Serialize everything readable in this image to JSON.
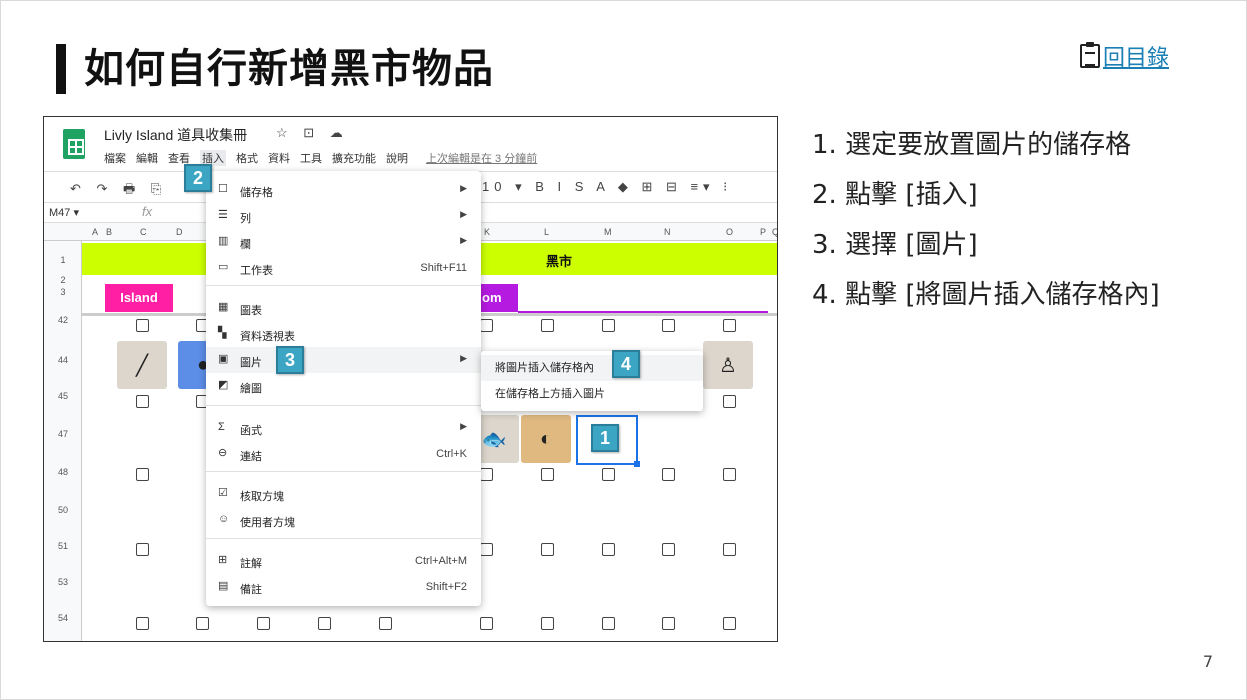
{
  "slide": {
    "title": "如何自行新增黑市物品",
    "toc_link": "回目錄",
    "page_number": "7",
    "steps": [
      "1.  選定要放置圖片的儲存格",
      "2.  點擊 [插入]",
      "3.  選擇 [圖片]",
      "4.  點擊 [將圖片插入儲存格內]"
    ]
  },
  "sheet": {
    "doc_title": "Livly Island 道具收集冊",
    "title_icons": "☆ ⊡ ☁",
    "menus": [
      "檔案",
      "編輯",
      "查看",
      "插入",
      "格式",
      "資料",
      "工具",
      "擴充功能",
      "說明"
    ],
    "active_menu_index": 3,
    "last_edit": "上次編輯是在 3 分鐘前",
    "toolbar_left": "↶ ↷ 🖶 ⎘",
    "toolbar_right": "10 ▾ B I S A ◆ ⊞ ⊟ ≡▾ ⁝",
    "name_box": "M47 ▾",
    "fx": "fx",
    "columns": [
      "A",
      "B",
      "C",
      "D",
      "K",
      "L",
      "M",
      "N",
      "O",
      "P",
      "Q"
    ],
    "rows": [
      "1",
      "2",
      "3",
      "42",
      "44",
      "45",
      "47",
      "48",
      "50",
      "51",
      "53",
      "54"
    ],
    "green_header": "黑市",
    "island_tag": "Island",
    "com_tag": "om",
    "insert_menu": [
      {
        "icon": "☐",
        "label": "儲存格",
        "shortcut": "",
        "arrow": "▶"
      },
      {
        "icon": "☰",
        "label": "列",
        "shortcut": "",
        "arrow": "▶"
      },
      {
        "icon": "▥",
        "label": "欄",
        "shortcut": "",
        "arrow": "▶"
      },
      {
        "icon": "▭",
        "label": "工作表",
        "shortcut": "Shift+F11",
        "arrow": ""
      },
      {
        "icon": "▦",
        "label": "圖表",
        "shortcut": "",
        "arrow": ""
      },
      {
        "icon": "▚",
        "label": "資料透視表",
        "shortcut": "",
        "arrow": ""
      },
      {
        "icon": "▣",
        "label": "圖片",
        "shortcut": "",
        "arrow": "▶"
      },
      {
        "icon": "◩",
        "label": "繪圖",
        "shortcut": "",
        "arrow": ""
      },
      {
        "icon": "Σ",
        "label": "函式",
        "shortcut": "",
        "arrow": "▶"
      },
      {
        "icon": "⊖",
        "label": "連結",
        "shortcut": "Ctrl+K",
        "arrow": ""
      },
      {
        "icon": "☑",
        "label": "核取方塊",
        "shortcut": "",
        "arrow": ""
      },
      {
        "icon": "☺",
        "label": "使用者方塊",
        "shortcut": "",
        "arrow": ""
      },
      {
        "icon": "⊞",
        "label": "註解",
        "shortcut": "Ctrl+Alt+M",
        "arrow": ""
      },
      {
        "icon": "▤",
        "label": "備註",
        "shortcut": "Shift+F2",
        "arrow": ""
      }
    ],
    "image_submenu": [
      "將圖片插入儲存格內",
      "在儲存格上方插入圖片"
    ],
    "badges": [
      "1",
      "2",
      "3",
      "4"
    ]
  }
}
